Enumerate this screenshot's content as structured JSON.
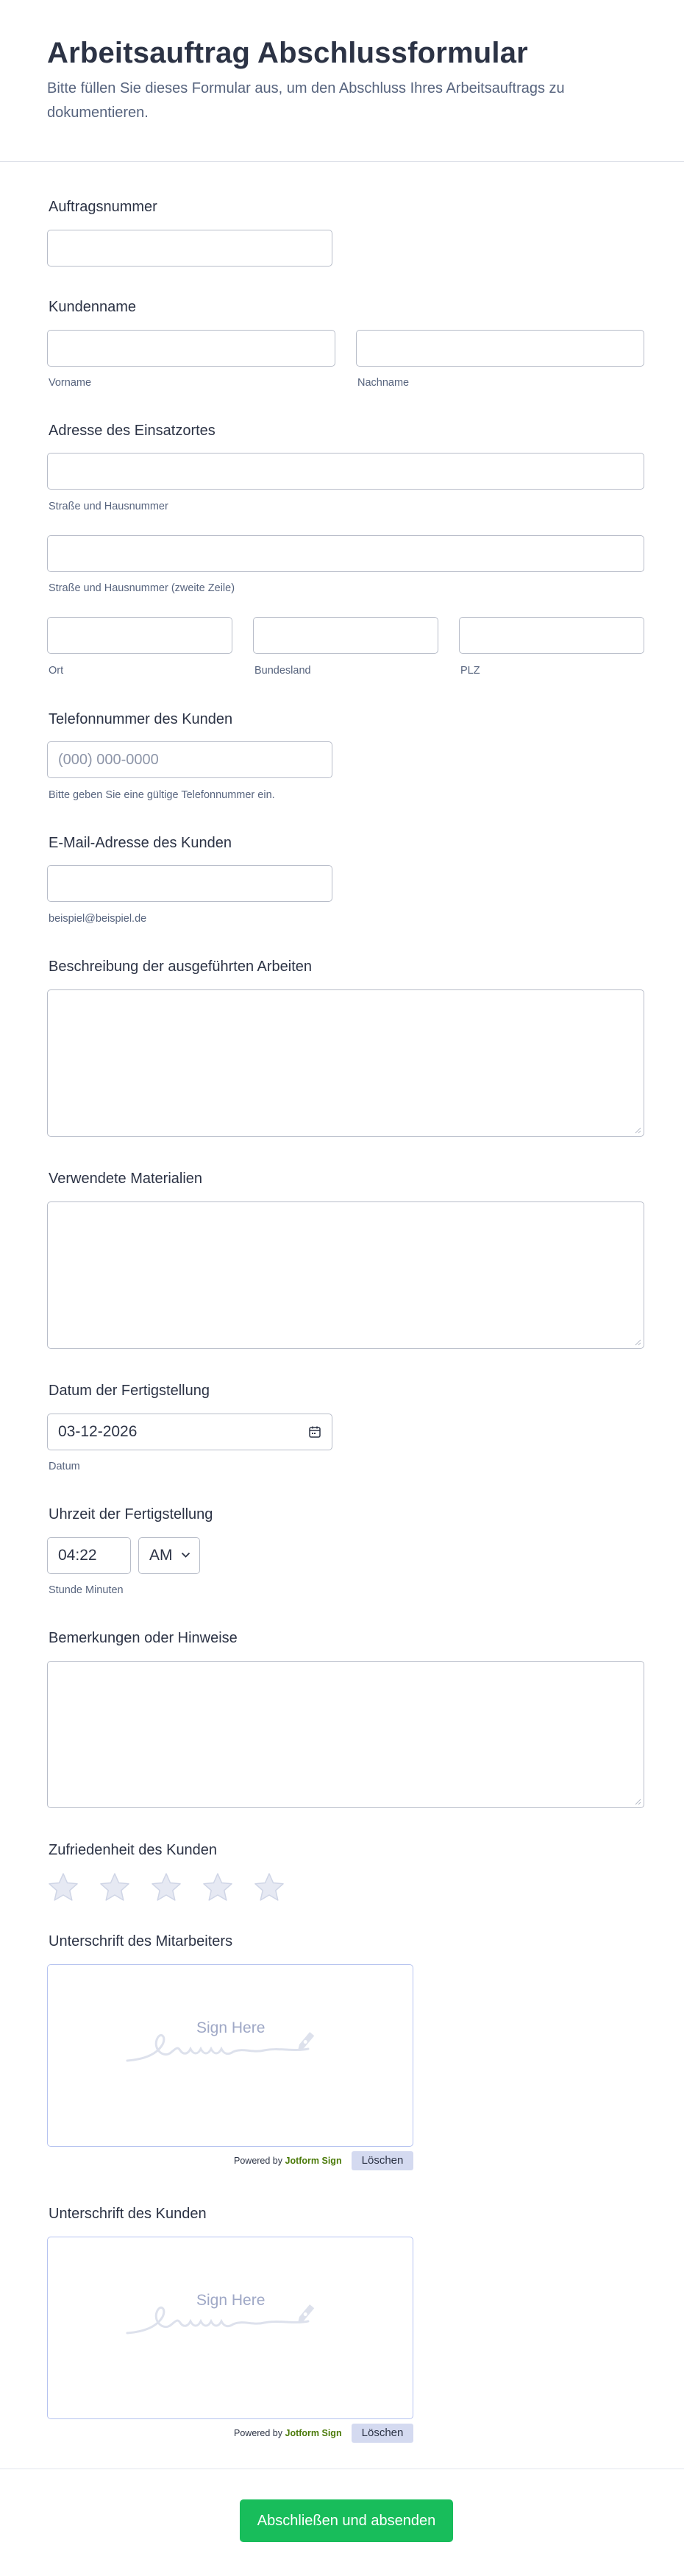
{
  "header": {
    "title": "Arbeitsauftrag Abschlussformular",
    "description": "Bitte füllen Sie dieses Formular aus, um den Abschluss Ihres Arbeitsauftrags zu dokumentieren."
  },
  "order_number": {
    "label": "Auftragsnummer",
    "value": ""
  },
  "customer_name": {
    "label": "Kundenname",
    "first_sub": "Vorname",
    "last_sub": "Nachname"
  },
  "address": {
    "label": "Adresse des Einsatzortes",
    "street_sub": "Straße und Hausnummer",
    "street2_sub": "Straße und Hausnummer (zweite Zeile)",
    "city_sub": "Ort",
    "state_sub": "Bundesland",
    "zip_sub": "PLZ"
  },
  "phone": {
    "label": "Telefonnummer des Kunden",
    "placeholder": "(000) 000-0000",
    "hint": "Bitte geben Sie eine gültige Telefonnummer ein."
  },
  "email": {
    "label": "E-Mail-Adresse des Kunden",
    "hint": "beispiel@beispiel.de"
  },
  "work_description": {
    "label": "Beschreibung der ausgeführten Arbeiten"
  },
  "materials": {
    "label": "Verwendete Materialien"
  },
  "completion_date": {
    "label": "Datum der Fertigstellung",
    "value": "03-12-2026",
    "sub": "Datum",
    "icon": "calendar-icon"
  },
  "completion_time": {
    "label": "Uhrzeit der Fertigstellung",
    "time": "04:22",
    "ampm": "AM",
    "sub": "Stunde Minuten"
  },
  "remarks": {
    "label": "Bemerkungen oder Hinweise"
  },
  "satisfaction": {
    "label": "Zufriedenheit des Kunden",
    "rating": 0,
    "max": 5
  },
  "employee_signature": {
    "label": "Unterschrift des Mitarbeiters",
    "placeholder": "Sign Here",
    "powered_prefix": "Powered by",
    "powered_brand": "Jotform Sign",
    "clear_label": "Löschen"
  },
  "customer_signature": {
    "label": "Unterschrift des Kunden",
    "placeholder": "Sign Here",
    "powered_prefix": "Powered by",
    "powered_brand": "Jotform Sign",
    "clear_label": "Löschen"
  },
  "submit": {
    "label": "Abschließen und absenden"
  },
  "colors": {
    "primary_text": "#2c3345",
    "secondary_text": "#57647e",
    "border": "#b8bdc9",
    "submit_bg": "#18bd5b",
    "brand_green": "#4b7a09",
    "clear_bg": "#d4daf0"
  }
}
